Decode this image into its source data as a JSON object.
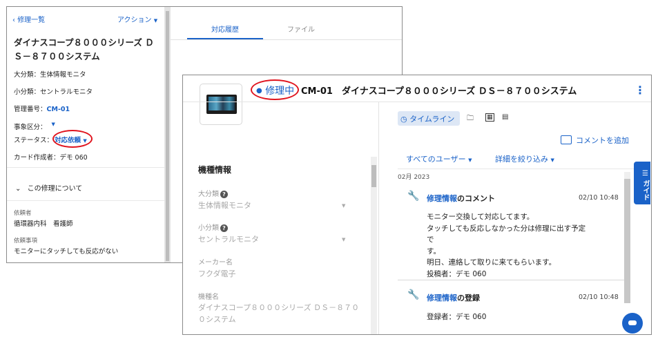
{
  "back_window": {
    "back_link": "修理一覧",
    "action_menu": "アクション",
    "title": "ダイナスコープ８０００シリーズ ＤＳ－８７００システム",
    "fields": {
      "major_category": "大分類：生体情報モニタ",
      "minor_category": "小分類：セントラルモニタ",
      "control_no_label": "管理番号：",
      "control_no_value": "CM-01",
      "incident_type": "事象区分：",
      "status_label": "ステータス：",
      "status_value": "対応依頼",
      "card_creator": "カード作成者：デモ 060"
    },
    "section": {
      "title": "この修理について",
      "requester_label": "依頼者",
      "requester_value": "循環器内科　看護師",
      "request_label": "依頼事項",
      "request_value": "モニターにタッチしても反応がない"
    },
    "tabs": [
      "対応履歴",
      "ファイル"
    ]
  },
  "front_window": {
    "status": "修理中",
    "title": "CM-01　ダイナスコープ８０００シリーズ ＤＳ－８７００システム",
    "left": {
      "section_title": "機種情報",
      "major_label": "大分類",
      "major_value": "生体情報モニタ",
      "minor_label": "小分類",
      "minor_value": "セントラルモニタ",
      "maker_label": "メーカー名",
      "maker_value": "フクダ電子",
      "model_label": "機種名",
      "model_value": "ダイナスコープ８０００シリーズ ＤＳ－８７００システム"
    },
    "right": {
      "timeline_button": "タイムライン",
      "add_comment": "コメントを追加",
      "filter_users": "すべてのユーザー",
      "filter_details": "詳細を絞り込み",
      "month": "02月 2023",
      "entries": [
        {
          "title_link": "修理情報",
          "title_suffix": "のコメント",
          "date": "02/10 10:48",
          "lines": [
            "モニター交換して対応してます。",
            "タッチしても反応しなかった分は修理に出す予定で",
            "す。",
            "明日、連絡して取りに来てもらいます。",
            "投稿者：デモ 060"
          ]
        },
        {
          "title_link": "修理情報",
          "title_suffix": "の登録",
          "date": "02/10 10:48",
          "lines": [
            "登録者：デモ 060"
          ]
        }
      ]
    },
    "guide_button": "ガイド"
  },
  "colors": {
    "accent": "#1a62c8",
    "highlight_oval": "#e0141e"
  }
}
